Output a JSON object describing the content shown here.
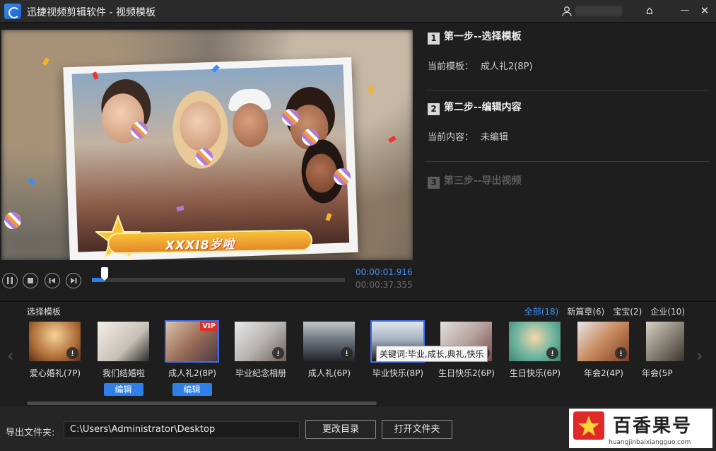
{
  "app": {
    "title": "迅捷视频剪辑软件 - 视频模板"
  },
  "window": {
    "home": "⌂",
    "minimize": "—",
    "close": "✕"
  },
  "preview": {
    "banner_text": "XXXI8岁啦"
  },
  "player": {
    "current_time": "00:00:01.916",
    "total_time": "00:00:37.355",
    "progress": 0.05
  },
  "steps": {
    "step1": {
      "num": "1",
      "title": "第一步--选择模板",
      "label": "当前模板：",
      "value": "成人礼2(8P)"
    },
    "step2": {
      "num": "2",
      "title": "第二步--编辑内容",
      "label": "当前内容：",
      "value": "未编辑"
    },
    "step3": {
      "num": "3",
      "title": "第三步--导出视频"
    }
  },
  "templates": {
    "title": "选择模板",
    "filters": [
      "全部(18)",
      "新篇章(6)",
      "宝宝(2)",
      "企业(10)"
    ],
    "active_filter": 0,
    "items": [
      {
        "name": "爱心婚礼(7P)",
        "download": true
      },
      {
        "name": "我们结婚啦",
        "edit": "编辑"
      },
      {
        "name": "成人礼2(8P)",
        "edit": "编辑",
        "vip": "VIP"
      },
      {
        "name": "毕业纪念相册",
        "download": true
      },
      {
        "name": "成人礼(6P)",
        "download": true
      },
      {
        "name": "毕业快乐(8P)",
        "download": true
      },
      {
        "name": "生日快乐2(6P)",
        "download": true
      },
      {
        "name": "生日快乐(6P)",
        "download": true
      },
      {
        "name": "年会2(4P)",
        "download": true
      },
      {
        "name": "年会(5P",
        "download": false
      }
    ],
    "tooltip": "关键词:毕业,成长,典礼,快乐"
  },
  "export": {
    "label": "导出文件夹:",
    "path": "C:\\Users\\Administrator\\Desktop",
    "change_dir": "更改目录",
    "open_folder": "打开文件夹"
  },
  "watermark": {
    "title": "百香果号",
    "url": "huangjinbaixiangguo.com"
  },
  "colors": {
    "accent": "#3f8ff5",
    "edit_button": "#2f7fe8",
    "background": "#1e1e1e"
  }
}
